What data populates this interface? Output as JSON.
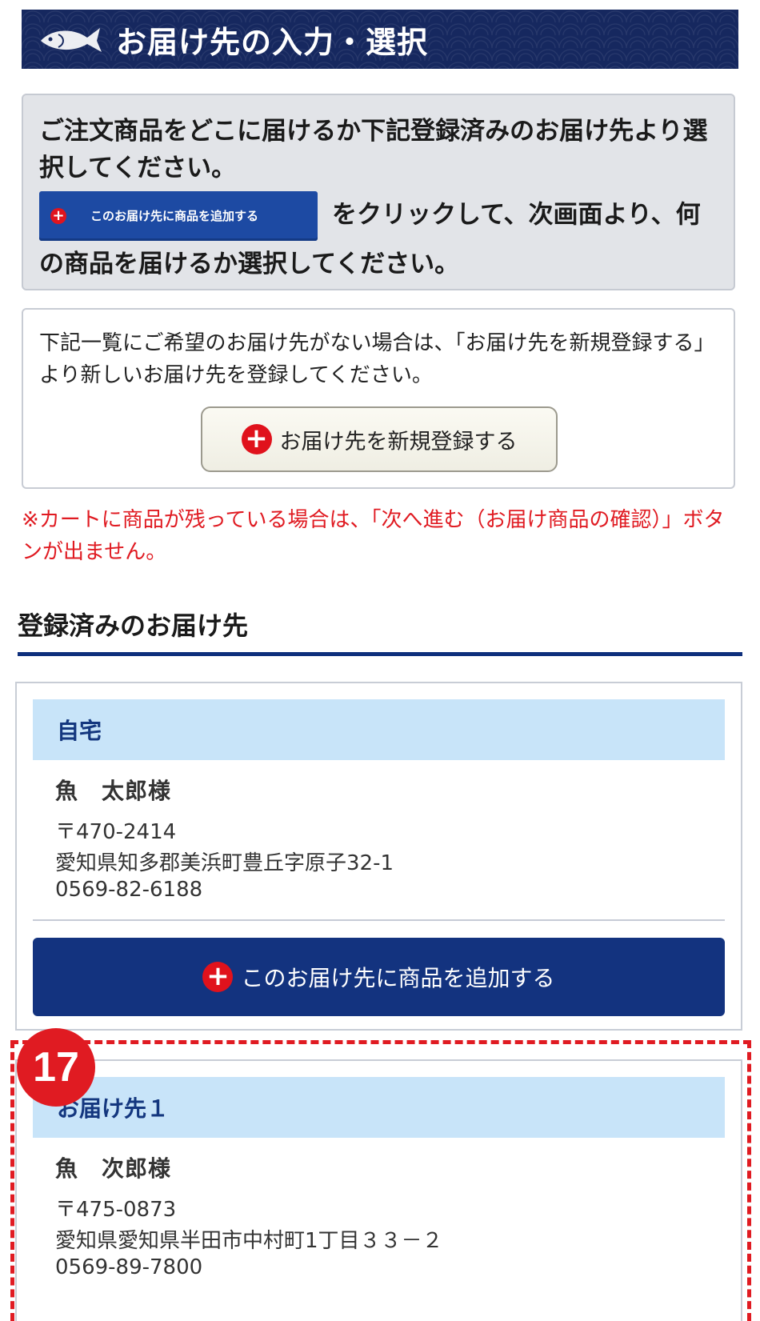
{
  "header": {
    "title": "お届け先の入力・選択",
    "icon": "fish-icon"
  },
  "instruction": {
    "line1": "ご注文商品をどこに届けるか下記登録済みのお届け先より選択してください。",
    "mini_button_label": "このお届け先に商品を追加する",
    "line2": "をクリックして、次画面より、何の商品を届けるか選択してください。"
  },
  "notice": {
    "text": "下記一覧にご希望のお届け先がない場合は、「お届け先を新規登録する」より新しいお届け先を登録してください。",
    "new_button_label": "お届け先を新規登録する"
  },
  "warning": "※カートに商品が残っている場合は、「次へ進む（お届け商品の確認）」ボタンが出ません。",
  "section": {
    "title": "登録済みのお届け先"
  },
  "addresses": [
    {
      "label": "自宅",
      "name": "魚　太郎様",
      "postal": "〒470-2414",
      "address": "愛知県知多郡美浜町豊丘字原子32-1",
      "phone": "0569-82-6188",
      "add_button_label": "このお届け先に商品を追加する"
    },
    {
      "label": "お届け先１",
      "name": "魚　次郎様",
      "postal": "〒475-0873",
      "address": "愛知県愛知県半田市中村町1丁目３３－２",
      "phone": "0569-89-7800"
    }
  ],
  "annotation": {
    "badge": "17",
    "color": "#e01b22"
  },
  "colors": {
    "navy": "#13337f",
    "light_blue": "#c8e4f9",
    "red": "#e01b22"
  }
}
